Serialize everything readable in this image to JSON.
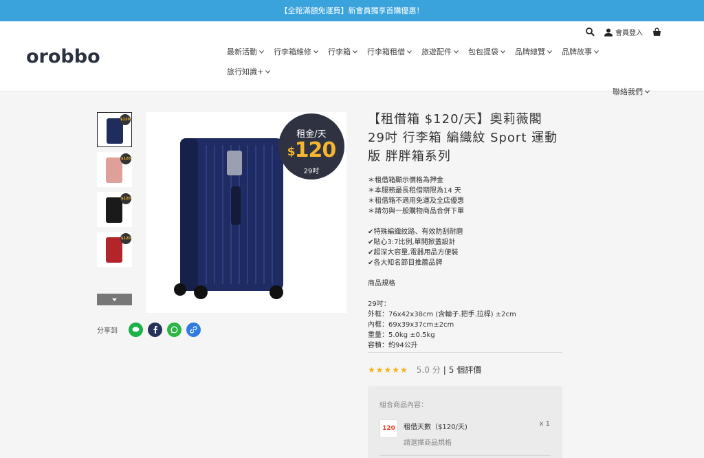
{
  "announcement": "【全館滿額免運費】新會員獨享首購優惠！",
  "header": {
    "logo_text": "orobbo",
    "login_label": "會員登入",
    "nav": [
      "最新活動",
      "行李箱維修",
      "行李箱",
      "行李箱租借",
      "旅遊配件",
      "包包提袋",
      "品牌總覽",
      "品牌故事",
      "旅行知識+",
      "聯絡我們"
    ]
  },
  "gallery": {
    "badge_line1": "租金/天",
    "badge_dollar": "$",
    "badge_price": "120",
    "badge_size": "29吋",
    "thumb_badge": "$120",
    "thumb_colors": [
      "#1f2d5c",
      "#e0a09a",
      "#1a1a1a",
      "#b3242b"
    ],
    "main_color": "#1f2b63"
  },
  "share": {
    "label": "分享到",
    "buttons": [
      {
        "icon": "line-icon",
        "color": "#19b347"
      },
      {
        "icon": "facebook-icon",
        "color": "#26325a"
      },
      {
        "icon": "whatsapp-icon",
        "color": "#2bb542"
      },
      {
        "icon": "link-icon",
        "color": "#2f7be0"
      }
    ]
  },
  "product": {
    "title": "【租借箱 $120/天】奧莉薇閣 29吋 行李箱 編織紋 Sport 運動版 胖胖箱系列",
    "notes": [
      "＊租借箱顯示價格為押金",
      "＊本服務最長租借期限為14 天",
      "＊租借箱不適用免運及全店優惠",
      "＊請勿與一般購物商品合併下單"
    ],
    "features": [
      "✔特殊編織紋路、有效防刮耐磨",
      "✔貼心3:7比例,單開掀蓋設計",
      "✔超深大容量,電器用品方便裝",
      "✔各大知名節目推薦品牌"
    ],
    "spec_heading": "商品規格",
    "specs": [
      "29吋：",
      "外框：76x42x38cm (含輪子.把手.拉桿) ±2cm",
      "內框：69x39x37cm±2cm",
      "重量：5.0kg ±0.5kg",
      "容積：約94公升"
    ],
    "stars": "★★★★★",
    "score": "5.0 分",
    "sep": "|",
    "reviews": "5 個評價"
  },
  "bundle": {
    "title": "組合商品內容：",
    "img_text": "120",
    "item_name": "租借天數（$120/天)",
    "qty": "x 1",
    "select_hint": "請選擇商品規格"
  }
}
